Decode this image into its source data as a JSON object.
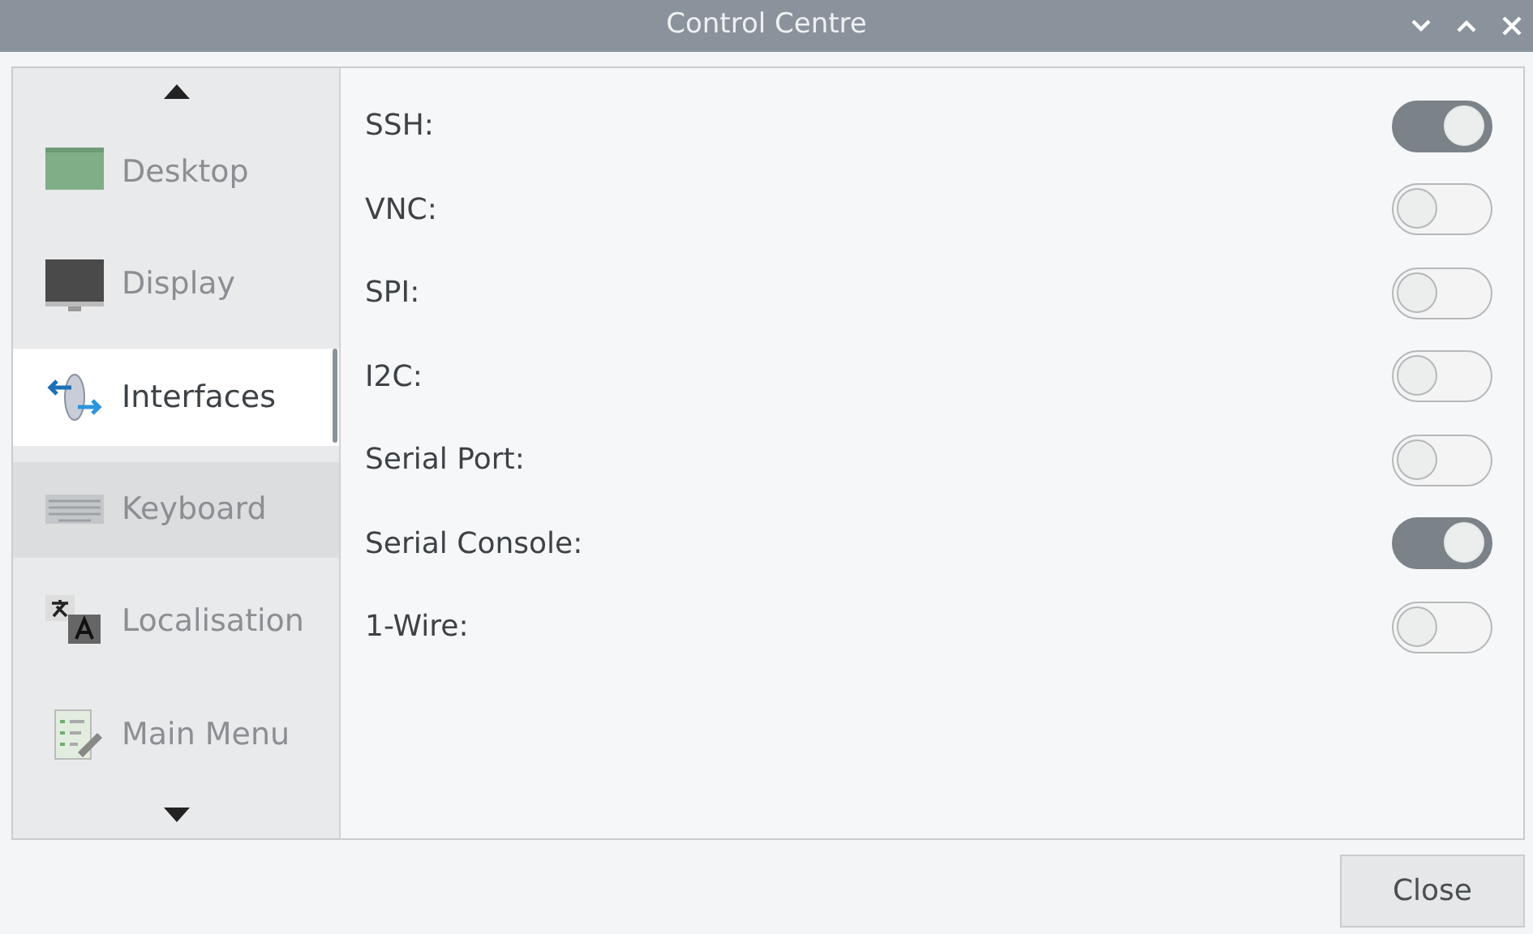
{
  "window": {
    "title": "Control Centre",
    "controls": [
      {
        "kind": "minimize"
      },
      {
        "kind": "maximize"
      },
      {
        "kind": "close"
      }
    ]
  },
  "sidebar": {
    "items": [
      {
        "label": "Desktop",
        "kind": "desktop",
        "selected": false,
        "hovered": false
      },
      {
        "label": "Display",
        "kind": "display",
        "selected": false,
        "hovered": false
      },
      {
        "label": "Interfaces",
        "kind": "interfaces",
        "selected": true,
        "hovered": false
      },
      {
        "label": "Keyboard",
        "kind": "keyboard",
        "selected": false,
        "hovered": true
      },
      {
        "label": "Localisation",
        "kind": "localisation",
        "selected": false,
        "hovered": false
      },
      {
        "label": "Main Menu",
        "kind": "mainmenu",
        "selected": false,
        "hovered": false
      }
    ]
  },
  "settings": [
    {
      "label": "SSH:",
      "on": true
    },
    {
      "label": "VNC:",
      "on": false
    },
    {
      "label": "SPI:",
      "on": false
    },
    {
      "label": "I2C:",
      "on": false
    },
    {
      "label": "Serial Port:",
      "on": false
    },
    {
      "label": "Serial Console:",
      "on": true
    },
    {
      "label": "1-Wire:",
      "on": false
    }
  ],
  "buttons": [
    "Close"
  ]
}
